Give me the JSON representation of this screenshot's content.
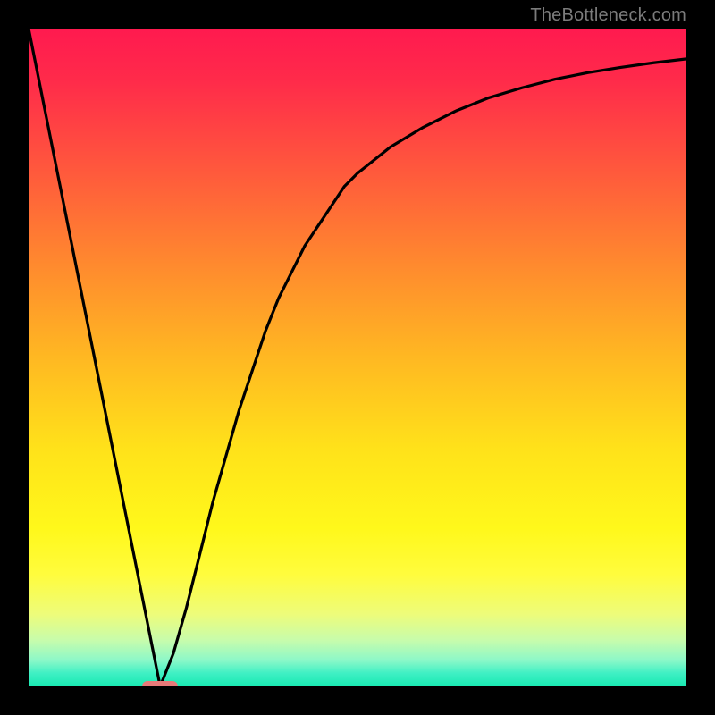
{
  "watermark": "TheBottleneck.com",
  "chart_data": {
    "type": "line",
    "title": "",
    "xlabel": "",
    "ylabel": "",
    "xlim": [
      0,
      100
    ],
    "ylim": [
      0,
      100
    ],
    "series": [
      {
        "name": "bottleneck-curve",
        "x": [
          0,
          2,
          4,
          6,
          8,
          10,
          12,
          14,
          16,
          18,
          20,
          22,
          24,
          26,
          28,
          30,
          32,
          34,
          36,
          38,
          40,
          42,
          44,
          46,
          48,
          50,
          55,
          60,
          65,
          70,
          75,
          80,
          85,
          90,
          95,
          100
        ],
        "values": [
          100,
          90,
          80,
          70,
          60,
          50,
          40,
          30,
          20,
          10,
          0,
          5,
          12,
          20,
          28,
          35,
          42,
          48,
          54,
          59,
          63,
          67,
          70,
          73,
          76,
          78,
          82,
          85,
          87.5,
          89.5,
          91,
          92.3,
          93.3,
          94.1,
          94.8,
          95.4
        ]
      }
    ],
    "marker": {
      "x": 20,
      "y": 0,
      "width_pct": 5.5,
      "height_pct": 1.5,
      "color": "#e77a79"
    },
    "gradient_colors": {
      "top": "#ff1a4f",
      "middle": "#ffe21a",
      "bottom": "#18e9b2"
    }
  }
}
